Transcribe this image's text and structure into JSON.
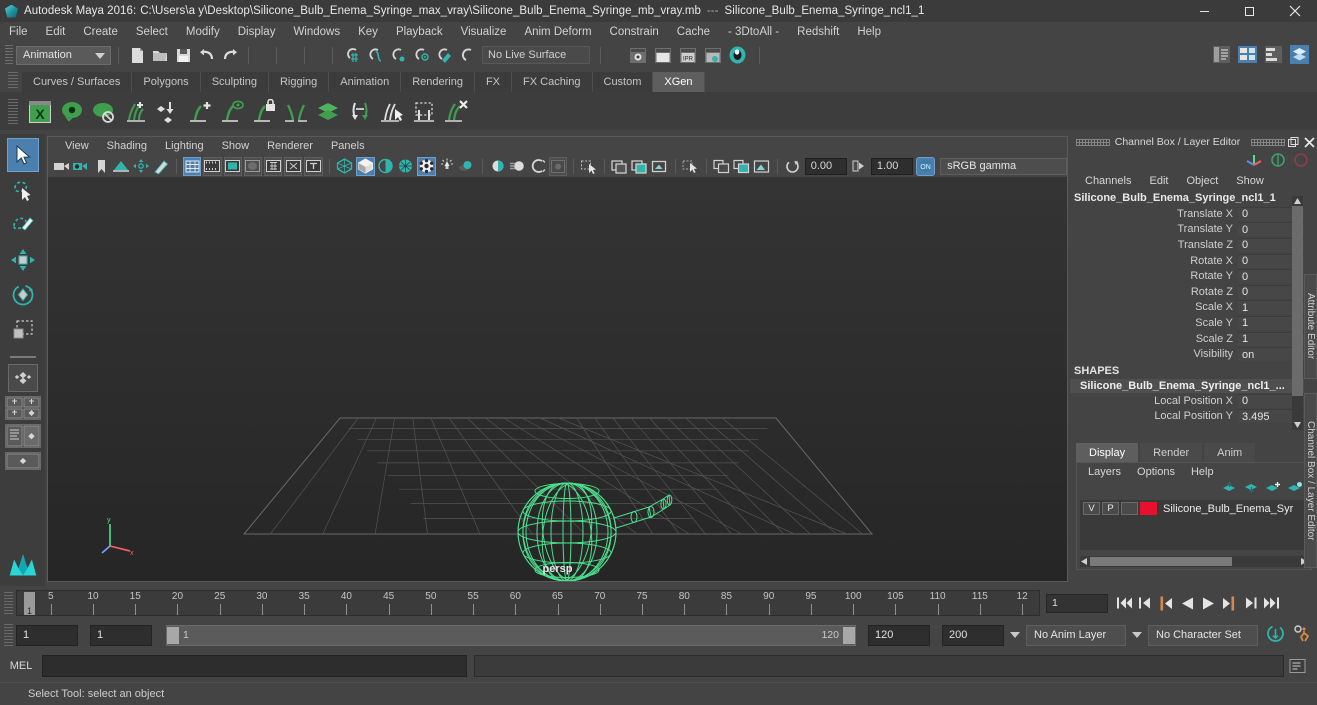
{
  "window": {
    "app_title": "Autodesk Maya 2016:",
    "file_path": "C:\\Users\\a y\\Desktop\\Silicone_Bulb_Enema_Syringe_max_vray\\Silicone_Bulb_Enema_Syringe_mb_vray.mb",
    "separator": "---",
    "selection_name": "Silicone_Bulb_Enema_Syringe_ncl1_1",
    "buttons": {
      "minimize": "minimize",
      "maximize": "maximize",
      "close": "close"
    }
  },
  "menubar": {
    "items": [
      "File",
      "Edit",
      "Create",
      "Select",
      "Modify",
      "Display",
      "Windows",
      "Key",
      "Playback",
      "Visualize",
      "Anim Deform",
      "Constrain",
      "Cache",
      "- 3DtoAll -",
      "Redshift",
      "Help"
    ]
  },
  "statusline": {
    "mode": "Animation",
    "live_surface": "No Live Surface",
    "icons": [
      "new-scene-icon",
      "open-scene-icon",
      "save-scene-icon",
      "undo-icon",
      "redo-icon",
      "snap-grid-icon",
      "snap-curve-icon",
      "snap-point-icon",
      "snap-projected-center-icon",
      "snap-view-plane-icon",
      "make-live-icon",
      "render-current-frame-icon",
      "ipr-render-icon",
      "render-settings-icon",
      "hypershade-icon",
      "render-view-icon",
      "show-hide-attribute-editor-icon",
      "show-hide-tool-settings-icon",
      "show-hide-channel-box-icon",
      "layer-editor-icon"
    ]
  },
  "shelf": {
    "tabs": [
      "Curves / Surfaces",
      "Polygons",
      "Sculpting",
      "Rigging",
      "Animation",
      "Rendering",
      "FX",
      "FX Caching",
      "Custom",
      "XGen"
    ],
    "active_tab": "XGen",
    "icons": [
      "xgen-window-icon",
      "xgen-preview-icon",
      "xgen-preview-off-icon",
      "xgen-add-description-icon",
      "xgen-place-guide-icon",
      "xgen-add-guide-icon",
      "xgen-guide-preview-icon",
      "xgen-lock-guide-icon",
      "xgen-mirror-guide-icon",
      "xgen-layers-icon",
      "xgen-convert-icon",
      "xgen-select-guide-icon",
      "xgen-region-icon",
      "xgen-delete-guide-icon"
    ]
  },
  "toolbox": {
    "items": [
      "select-tool",
      "lasso-select-tool",
      "paint-select-tool",
      "move-tool",
      "rotate-tool",
      "scale-tool"
    ],
    "active": "select-tool",
    "layout_items": [
      "single-perspective-view-icon",
      "four-view-layout-icon",
      "persp-outliner-layout-icon",
      "persp-graph-layout-icon"
    ],
    "bookmark": "maya-logo-icon"
  },
  "viewport": {
    "menu": [
      "View",
      "Shading",
      "Lighting",
      "Show",
      "Renderer",
      "Panels"
    ],
    "camera_label": "persp",
    "exposure": "0.00",
    "gamma": "1.00",
    "color_space": "sRGB gamma",
    "toolbar_icons": [
      "select-camera-icon",
      "camera-attributes-icon",
      "bookmark-icon",
      "image-plane-icon",
      "two-d-pan-zoom-icon",
      "grease-pencil-icon",
      "grid-toggle-icon",
      "film-gate-icon",
      "resolution-gate-icon",
      "gate-mask-icon",
      "field-chart-icon",
      "safe-action-icon",
      "safe-title-icon",
      "wireframe-icon",
      "smooth-shade-all-icon",
      "shade-flat-icon",
      "wireframe-on-shaded-icon",
      "texture-toggle-icon",
      "use-all-lights-icon",
      "shadows-icon",
      "screen-space-ao-icon",
      "motion-blur-icon",
      "multisample-icon",
      "xray-icon",
      "xray-joints-icon",
      "isolate-select-icon",
      "snapshot-icon",
      "panel-zoom-in-icon",
      "panel-zoom-out-icon"
    ]
  },
  "channelbox": {
    "panel_title": "Channel Box / Layer Editor",
    "menu": [
      "Channels",
      "Edit",
      "Object",
      "Show"
    ],
    "node_name": "Silicone_Bulb_Enema_Syringe_ncl1_1",
    "channels": [
      {
        "label": "Translate X",
        "value": "0"
      },
      {
        "label": "Translate Y",
        "value": "0"
      },
      {
        "label": "Translate Z",
        "value": "0"
      },
      {
        "label": "Rotate X",
        "value": "0"
      },
      {
        "label": "Rotate Y",
        "value": "0"
      },
      {
        "label": "Rotate Z",
        "value": "0"
      },
      {
        "label": "Scale X",
        "value": "1"
      },
      {
        "label": "Scale Y",
        "value": "1"
      },
      {
        "label": "Scale Z",
        "value": "1"
      },
      {
        "label": "Visibility",
        "value": "on"
      }
    ],
    "shapes_header": "SHAPES",
    "shape_name": "Silicone_Bulb_Enema_Syringe_ncl1_...",
    "shape_channels": [
      {
        "label": "Local Position X",
        "value": "0"
      },
      {
        "label": "Local Position Y",
        "value": "3.495"
      }
    ]
  },
  "layereditor": {
    "tabs": [
      "Display",
      "Render",
      "Anim"
    ],
    "active_tab": "Display",
    "menu": [
      "Layers",
      "Options",
      "Help"
    ],
    "toolbar_icons": [
      "layer-move-up-icon",
      "layer-move-down-icon",
      "create-new-layer-icon",
      "create-layer-from-selected-icon"
    ],
    "layers": [
      {
        "visibility": "V",
        "playback": "P",
        "type": "",
        "color": "#e8112d",
        "name": "Silicone_Bulb_Enema_Syr"
      }
    ]
  },
  "docktabs": {
    "right": [
      "Attribute Editor",
      "Channel Box / Layer Editor"
    ]
  },
  "timeslider": {
    "current_frame": "1",
    "current_frame_field": "1",
    "tick_labels": [
      "5",
      "10",
      "15",
      "20",
      "25",
      "30",
      "35",
      "40",
      "45",
      "50",
      "55",
      "60",
      "65",
      "70",
      "75",
      "80",
      "85",
      "90",
      "95",
      "100",
      "105",
      "110",
      "115",
      "12"
    ],
    "playback_buttons": [
      "go-to-start-icon",
      "step-back-keyframe-icon",
      "step-back-frame-icon",
      "play-backwards-icon",
      "play-forwards-icon",
      "step-forward-frame-icon",
      "step-forward-keyframe-icon",
      "go-to-end-icon"
    ]
  },
  "rangeslider": {
    "anim_start": "1",
    "range_start": "1",
    "bar_start": "1",
    "bar_end": "120",
    "range_end": "120",
    "anim_end": "200",
    "anim_layer": "No Anim Layer",
    "character_set": "No Character Set",
    "auto_keyframe_icon": "auto-keyframe-toggle-icon",
    "anim_prefs_icon": "animation-preferences-icon"
  },
  "commandline": {
    "language": "MEL",
    "input_value": "",
    "output_value": "",
    "script_editor_icon": "script-editor-icon"
  },
  "statusbar": {
    "help_text": "Select Tool: select an object"
  },
  "colors": {
    "accent_blue": "#4b7fae",
    "teal": "#2fb5ad",
    "green_wire": "#4ce08d",
    "layer_red": "#e8112d",
    "orange": "#d78a46"
  }
}
